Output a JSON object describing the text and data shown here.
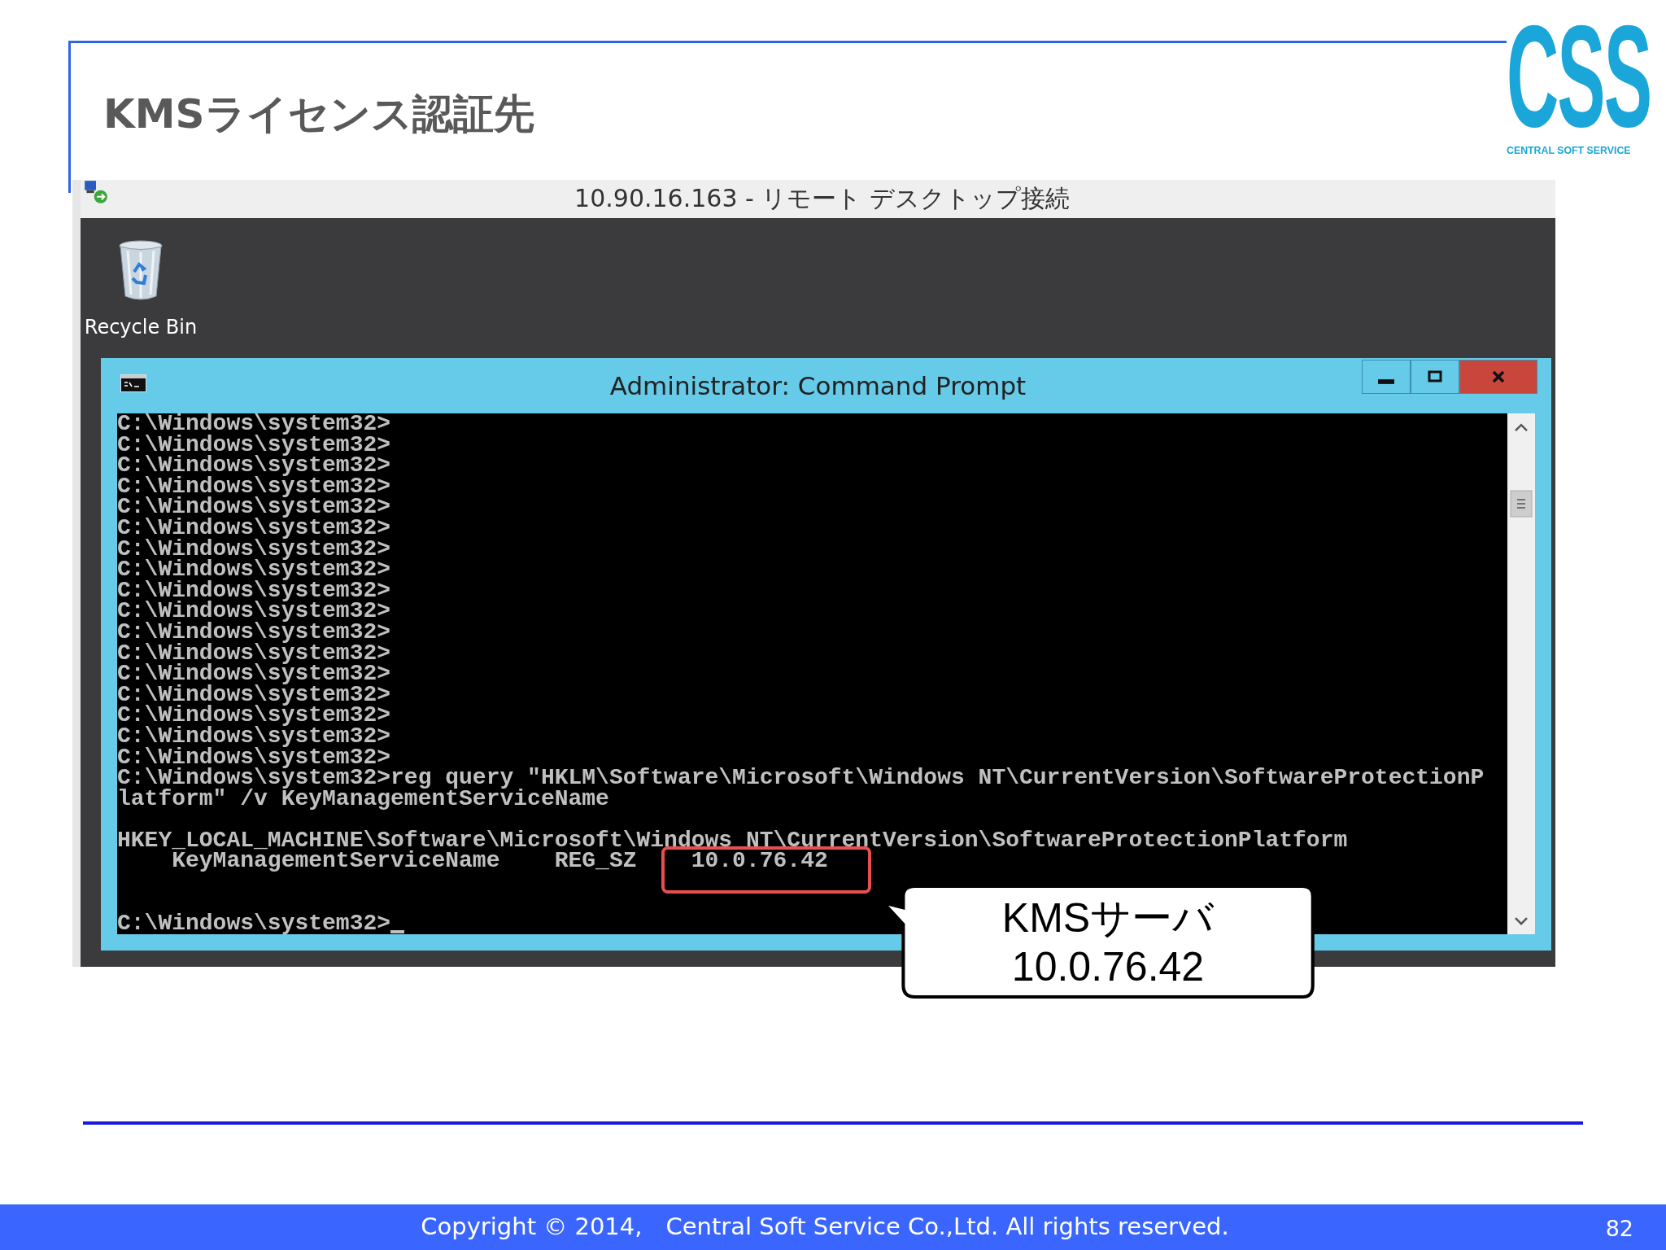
{
  "slide": {
    "title": "KMSライセンス認証先",
    "logo": {
      "letters": "CSS",
      "tagline": "CENTRAL SOFT SERVICE"
    },
    "footer": {
      "copyright": "Copyright © 2014,　Central Soft Service Co.,Ltd. All rights reserved.",
      "page_number": "82"
    }
  },
  "remote_desktop": {
    "title": "10.90.16.163 - リモート デスクトップ接続",
    "desktop_icons": [
      {
        "label": "Recycle Bin"
      }
    ],
    "command_prompt": {
      "title": "Administrator: Command Prompt",
      "lines": [
        {
          "kind": "text",
          "text": "C:\\Windows\\system32>"
        },
        {
          "kind": "text",
          "text": "C:\\Windows\\system32>"
        },
        {
          "kind": "text",
          "text": "C:\\Windows\\system32>"
        },
        {
          "kind": "text",
          "text": "C:\\Windows\\system32>"
        },
        {
          "kind": "text",
          "text": "C:\\Windows\\system32>"
        },
        {
          "kind": "text",
          "text": "C:\\Windows\\system32>"
        },
        {
          "kind": "text",
          "text": "C:\\Windows\\system32>"
        },
        {
          "kind": "text",
          "text": "C:\\Windows\\system32>"
        },
        {
          "kind": "text",
          "text": "C:\\Windows\\system32>"
        },
        {
          "kind": "text",
          "text": "C:\\Windows\\system32>"
        },
        {
          "kind": "text",
          "text": "C:\\Windows\\system32>"
        },
        {
          "kind": "text",
          "text": "C:\\Windows\\system32>"
        },
        {
          "kind": "text",
          "text": "C:\\Windows\\system32>"
        },
        {
          "kind": "text",
          "text": "C:\\Windows\\system32>"
        },
        {
          "kind": "text",
          "text": "C:\\Windows\\system32>"
        },
        {
          "kind": "text",
          "text": "C:\\Windows\\system32>"
        },
        {
          "kind": "text",
          "text": "C:\\Windows\\system32>"
        },
        {
          "kind": "text",
          "text": "C:\\Windows\\system32>reg query \"HKLM\\Software\\Microsoft\\Windows NT\\CurrentVersion\\SoftwareProtectionP"
        },
        {
          "kind": "text",
          "text": "latform\" /v KeyManagementServiceName"
        },
        {
          "kind": "blank"
        },
        {
          "kind": "text",
          "text": "HKEY_LOCAL_MACHINE\\Software\\Microsoft\\Windows NT\\CurrentVersion\\SoftwareProtectionPlatform"
        },
        {
          "kind": "text",
          "text": "    KeyManagementServiceName    REG_SZ    ",
          "boxed_value": "10.0.76.42"
        },
        {
          "kind": "blank"
        },
        {
          "kind": "blank"
        },
        {
          "kind": "text",
          "text": "C:\\Windows\\system32>",
          "cursor": true
        }
      ]
    },
    "callout": {
      "lines": [
        "KMSサーバ",
        "10.0.76.42"
      ]
    }
  }
}
